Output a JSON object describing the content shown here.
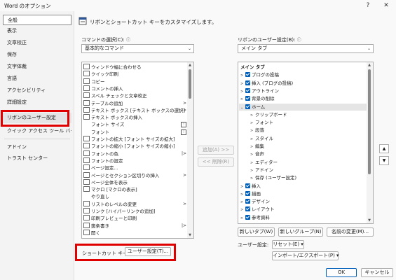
{
  "window": {
    "title": "Word のオプション",
    "help": "?",
    "close": "✕"
  },
  "sidebar": {
    "items": [
      {
        "label": "全般"
      },
      {
        "label": "表示"
      },
      {
        "label": "文章校正"
      },
      {
        "label": "保存"
      },
      {
        "label": "文字体裁"
      },
      {
        "label": "言語"
      },
      {
        "label": "アクセシビリティ"
      },
      {
        "label": "詳細設定"
      },
      {
        "label": "リボンのユーザー設定"
      },
      {
        "label": "クイック アクセス ツール バー"
      },
      {
        "label": "アドイン"
      },
      {
        "label": "トラスト センター"
      }
    ],
    "active_index": 8
  },
  "header": {
    "text": "リボンとショートカット キーをカスタマイズします。"
  },
  "commands": {
    "label": "コマンドの選択(C):",
    "info": "ⓘ",
    "selected": "基本的なコマンド",
    "items": [
      {
        "icon": "fit-window-icon",
        "label": "ウィンドウ幅に合わせる",
        "trail": ""
      },
      {
        "icon": "quick-print-icon",
        "label": "クイック印刷",
        "trail": ""
      },
      {
        "icon": "copy-icon",
        "label": "コピー",
        "trail": ""
      },
      {
        "icon": "comment-insert-icon",
        "label": "コメントの挿入",
        "trail": ""
      },
      {
        "icon": "spelling-icon",
        "label": "スペル チェックと文章校正",
        "trail": ""
      },
      {
        "icon": "table-add-icon",
        "label": "テーブルの追加",
        "trail": ">"
      },
      {
        "icon": "textbox-icon",
        "label": "テキスト ボックス [テキスト ボックスの選択]",
        "trail": ">"
      },
      {
        "icon": "textbox-insert-icon",
        "label": "テキスト ボックスの挿入",
        "trail": ""
      },
      {
        "icon": "",
        "label": "フォント サイズ",
        "trail": "box"
      },
      {
        "icon": "",
        "label": "フォント",
        "trail": "box"
      },
      {
        "icon": "font-grow-icon",
        "label": "フォントの拡大 [フォント サイズの拡大]",
        "trail": ""
      },
      {
        "icon": "font-shrink-icon",
        "label": "フォントの縮小 [フォント サイズの縮小]",
        "trail": ""
      },
      {
        "icon": "font-color-icon",
        "label": "フォントの色",
        "trail": "|>"
      },
      {
        "icon": "font-settings-icon",
        "label": "フォントの設定",
        "trail": ""
      },
      {
        "icon": "page-setup-icon",
        "label": "ページ設定...",
        "trail": ""
      },
      {
        "icon": "page-break-icon",
        "label": "ページとセクション区切りの挿入",
        "trail": ">"
      },
      {
        "icon": "full-page-icon",
        "label": "ページ全体を表示",
        "trail": ""
      },
      {
        "icon": "macro-icon",
        "label": "マクロ [マクロの表示]",
        "trail": ""
      },
      {
        "icon": "",
        "label": "やり直し",
        "trail": ""
      },
      {
        "icon": "list-level-icon",
        "label": "リストのレベルの変更",
        "trail": ">"
      },
      {
        "icon": "link-icon",
        "label": "リンク [ハイパーリンクの追加]",
        "trail": ""
      },
      {
        "icon": "print-preview-icon",
        "label": "印刷プレビューと印刷",
        "trail": ""
      },
      {
        "icon": "bullets-icon",
        "label": "箇条書き",
        "trail": "|>"
      },
      {
        "icon": "open-icon",
        "label": "開く",
        "trail": ""
      }
    ]
  },
  "middle": {
    "add": "追加(A) >>",
    "remove": "<< 削除(R)"
  },
  "ribbon": {
    "label": "リボンのユーザー設定(B):",
    "info": "ⓘ",
    "selected": "メイン タブ",
    "items": [
      {
        "level": 0,
        "tri": "",
        "check": false,
        "label": "メイン タブ",
        "bold": true
      },
      {
        "level": 0,
        "tri": ">",
        "check": true,
        "label": "ブログの投稿"
      },
      {
        "level": 0,
        "tri": ">",
        "check": true,
        "label": "挿入 (ブログの投稿)"
      },
      {
        "level": 0,
        "tri": ">",
        "check": true,
        "label": "アウトライン"
      },
      {
        "level": 0,
        "tri": ">",
        "check": true,
        "label": "背景の削除"
      },
      {
        "level": 0,
        "tri": "v",
        "check": true,
        "label": "ホーム",
        "selected": true
      },
      {
        "level": 1,
        "tri": ">",
        "check": false,
        "label": "クリップボード"
      },
      {
        "level": 1,
        "tri": ">",
        "check": false,
        "label": "フォント"
      },
      {
        "level": 1,
        "tri": ">",
        "check": false,
        "label": "段落"
      },
      {
        "level": 1,
        "tri": ">",
        "check": false,
        "label": "スタイル"
      },
      {
        "level": 1,
        "tri": ">",
        "check": false,
        "label": "編集"
      },
      {
        "level": 1,
        "tri": ">",
        "check": false,
        "label": "音声"
      },
      {
        "level": 1,
        "tri": ">",
        "check": false,
        "label": "エディター"
      },
      {
        "level": 1,
        "tri": ">",
        "check": false,
        "label": "アドイン"
      },
      {
        "level": 1,
        "tri": ">",
        "check": false,
        "label": "保存 (ユーザー設定)"
      },
      {
        "level": 0,
        "tri": ">",
        "check": true,
        "label": "挿入"
      },
      {
        "level": 0,
        "tri": ">",
        "check": true,
        "label": "描画"
      },
      {
        "level": 0,
        "tri": ">",
        "check": true,
        "label": "デザイン"
      },
      {
        "level": 0,
        "tri": ">",
        "check": true,
        "label": "レイアウト"
      },
      {
        "level": 0,
        "tri": ">",
        "check": true,
        "label": "参考資料"
      }
    ],
    "up": "▲",
    "down": "▼"
  },
  "ribbon_buttons": {
    "new_tab": "新しいタブ(W)",
    "new_group": "新しいグループ(N)",
    "rename": "名前の変更(M)...",
    "user_settings_label": "ユーザー設定:",
    "reset": "リセット(E) ▾",
    "import_export": "インポート/エクスポート(P) ▾"
  },
  "shortcut": {
    "label": "ショートカット キー:",
    "button": "ユーザー設定(T)..."
  },
  "footer": {
    "ok": "OK",
    "cancel": "キャンセル"
  },
  "colors": {
    "accent": "#005fb8",
    "highlight": "#e00000"
  }
}
